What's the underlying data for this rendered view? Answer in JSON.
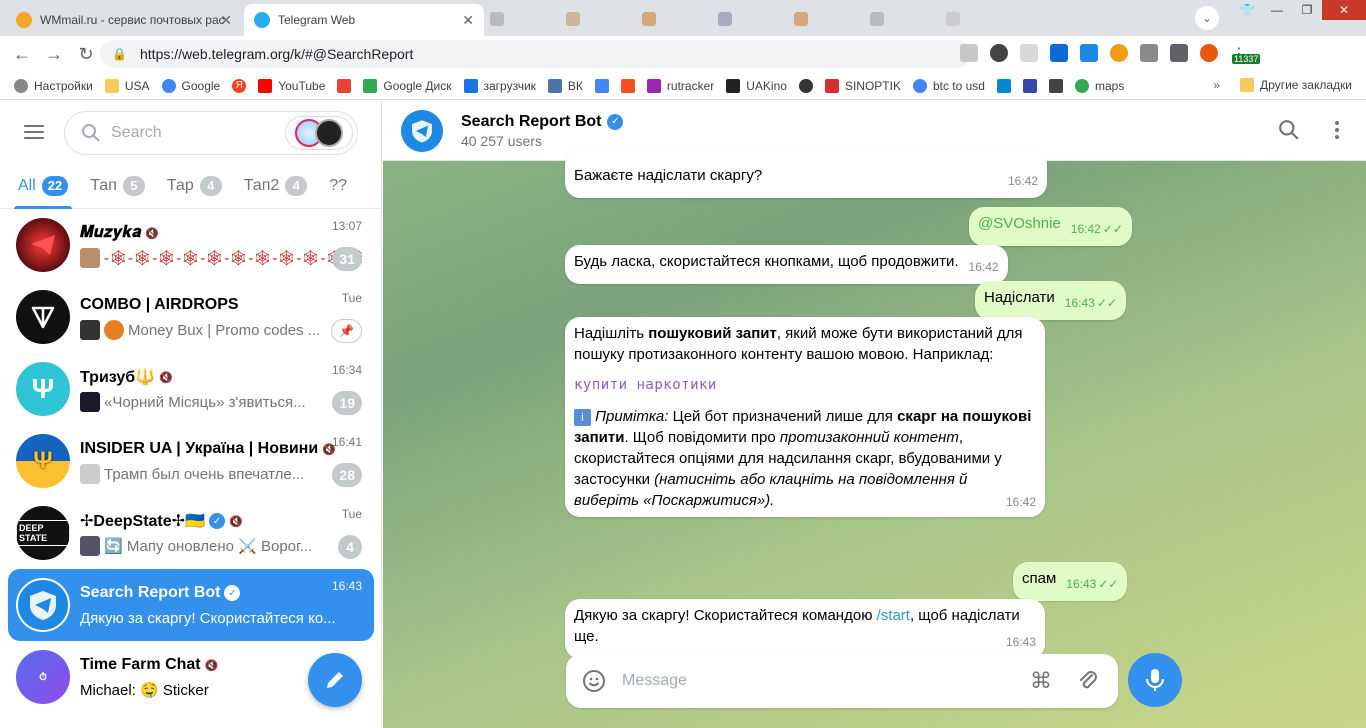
{
  "browser": {
    "tabs": [
      {
        "title": "WMmail.ru - сервис почтовых рас",
        "active": false
      },
      {
        "title": "Telegram Web",
        "active": true
      }
    ],
    "url": "https://web.telegram.org/k/#@SearchReport",
    "bookmarks": [
      "Настройки",
      "USA",
      "Google",
      "Я",
      "YouTube",
      "Google Диск",
      "загрузчик",
      "ВК",
      "rutracker",
      "UAKino",
      "SINOPTIK",
      "btc to usd",
      "maps"
    ],
    "other_bookmarks": "Другие закладки",
    "more_label": "»",
    "ext_badge": "11337"
  },
  "sidebar": {
    "search_placeholder": "Search",
    "folders": [
      {
        "label": "All",
        "count": "22",
        "active": true
      },
      {
        "label": "Тап",
        "count": "5",
        "active": false
      },
      {
        "label": "Тар",
        "count": "4",
        "active": false
      },
      {
        "label": "Тап2",
        "count": "4",
        "active": false
      },
      {
        "label": "??",
        "count": "",
        "active": false
      }
    ],
    "chats": [
      {
        "title": "𝑴𝒖𝒛𝒚𝒌𝒂",
        "preview": "-🕸-🕸-🕸-🕸-🕸-🕸-🕸-🕸-🕸-🕸-🕸",
        "time": "13:07",
        "badge": "31"
      },
      {
        "title": "COMBO | AIRDROPS",
        "preview": "Money Bux | Promo codes ...",
        "time": "Tue",
        "badge": ""
      },
      {
        "title": "Тризуб🔱",
        "preview": "«Чорний Місяць» з'явиться...",
        "time": "16:34",
        "badge": "19"
      },
      {
        "title": "INSIDER UA | Україна | Новини",
        "preview": "Трамп был очень впечатле...",
        "time": "16:41",
        "badge": "28"
      },
      {
        "title": "✢DeepState✢🇺🇦",
        "preview": "🔄 Мапу оновлено ⚔️ Ворог...",
        "time": "Tue",
        "badge": "4"
      },
      {
        "title": "Search Report Bot",
        "preview": "Дякую за скаргу! Скористайтеся ко...",
        "time": "16:43",
        "badge": ""
      },
      {
        "title": "Time Farm Chat",
        "preview": "Michael: 🤤 Sticker",
        "time": "",
        "badge": ""
      }
    ]
  },
  "chat": {
    "title": "Search Report Bot",
    "subtitle": "40 257 users",
    "messages": [
      {
        "dir": "in",
        "text": "Бажаєте надіслати скаргу?",
        "time": "16:42"
      },
      {
        "dir": "out",
        "text": "@SVOshnie",
        "time": "16:42"
      },
      {
        "dir": "in",
        "text": "Будь ласка, скористайтеся кнопками, щоб продовжити.",
        "time": "16:42"
      },
      {
        "dir": "out",
        "text": "Надіслати",
        "time": "16:43"
      },
      {
        "dir": "in",
        "p1a": "Надішліть ",
        "p1b": "пошуковий запит",
        "p1c": ", який може бути використаний для пошуку протизаконного контенту вашою мовою. Наприклад:",
        "example": "купити наркотики",
        "note_label": "Примітка:",
        "note_a": " Цей бот призначений лише для ",
        "note_b": "скарг на пошукові запити",
        "note_c": ". Щоб повідомити про ",
        "note_d": "протизаконний контент",
        "note_e": ", скористайтеся опціями для надсилання скарг, вбудованими у застосунки ",
        "note_f": "(натисніть або клацніть на повідомлення й виберіть «Поскаржитися»).",
        "time": "16:42"
      },
      {
        "dir": "out",
        "text": "спам",
        "time": "16:43"
      },
      {
        "dir": "in",
        "a": "Дякую за скаргу! Скористайтеся командою ",
        "cmd": "/start",
        "b": ", щоб надіслати ще.",
        "time": "16:43"
      }
    ],
    "composer_placeholder": "Message"
  }
}
